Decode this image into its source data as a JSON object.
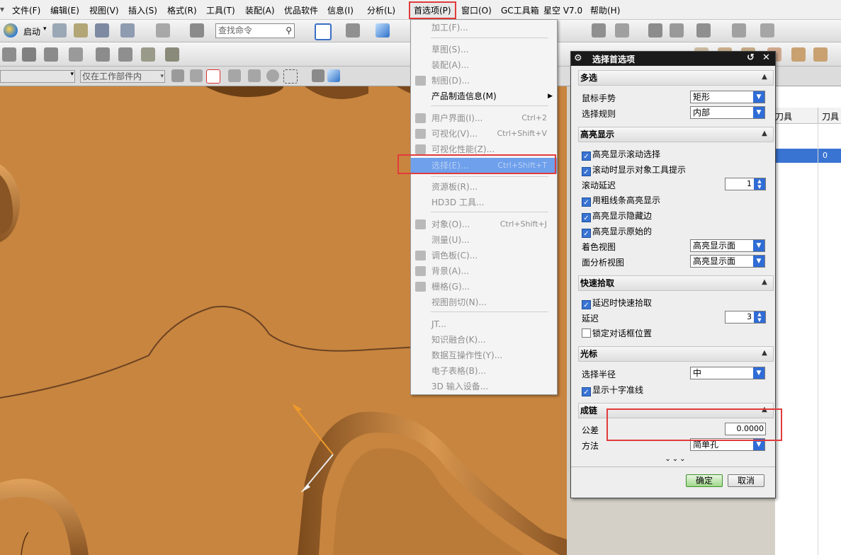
{
  "menubar": {
    "items": [
      "文件(F)",
      "编辑(E)",
      "视图(V)",
      "插入(S)",
      "格式(R)",
      "工具(T)",
      "装配(A)",
      "优品软件",
      "信息(I)",
      "分析(L)",
      "首选项(P)",
      "窗口(O)",
      "GC工具箱",
      "星空 V7.0",
      "帮助(H)"
    ],
    "active_item": "首选项(P)"
  },
  "toolbar": {
    "start_label": "启动",
    "search_placeholder": "查找命令",
    "filter_label": "仅在工作部件内"
  },
  "dropdown": {
    "items": [
      {
        "label": "加工(F)...",
        "shortcut": "",
        "enabled": false
      },
      {
        "label": "草图(S)...",
        "shortcut": "",
        "enabled": false
      },
      {
        "label": "装配(A)...",
        "shortcut": "",
        "enabled": false
      },
      {
        "label": "制图(D)...",
        "shortcut": "",
        "enabled": false
      },
      {
        "label": "产品制造信息(M)",
        "shortcut": "",
        "enabled": true,
        "submenu": "▶"
      },
      {
        "label": "用户界面(I)...",
        "shortcut": "Ctrl+2",
        "enabled": false
      },
      {
        "label": "可视化(V)...",
        "shortcut": "Ctrl+Shift+V",
        "enabled": false
      },
      {
        "label": "可视化性能(Z)...",
        "shortcut": "",
        "enabled": false
      },
      {
        "label": "选择(E)...",
        "shortcut": "Ctrl+Shift+T",
        "enabled": true,
        "selected": true
      },
      {
        "label": "资源板(R)...",
        "shortcut": "",
        "enabled": false
      },
      {
        "label": "HD3D 工具...",
        "shortcut": "",
        "enabled": false
      },
      {
        "label": "对象(O)...",
        "shortcut": "Ctrl+Shift+J",
        "enabled": false
      },
      {
        "label": "测量(U)...",
        "shortcut": "",
        "enabled": false
      },
      {
        "label": "调色板(C)...",
        "shortcut": "",
        "enabled": false
      },
      {
        "label": "背景(A)...",
        "shortcut": "",
        "enabled": false
      },
      {
        "label": "栅格(G)...",
        "shortcut": "",
        "enabled": false
      },
      {
        "label": "视图剖切(N)...",
        "shortcut": "",
        "enabled": false
      },
      {
        "label": "JT...",
        "shortcut": "",
        "enabled": false
      },
      {
        "label": "知识融合(K)...",
        "shortcut": "",
        "enabled": false
      },
      {
        "label": "数据互操作性(Y)...",
        "shortcut": "",
        "enabled": false
      },
      {
        "label": "电子表格(B)...",
        "shortcut": "",
        "enabled": false
      },
      {
        "label": "3D 输入设备...",
        "shortcut": "",
        "enabled": false
      }
    ]
  },
  "dialog": {
    "title": "选择首选项",
    "sections": {
      "multiselect": {
        "title": "多选",
        "gesture_label": "鼠标手势",
        "gesture_value": "矩形",
        "rule_label": "选择规则",
        "rule_value": "内部"
      },
      "highlight": {
        "title": "高亮显示",
        "scroll_select": "高亮显示滚动选择",
        "scroll_tooltip": "滚动时显示对象工具提示",
        "scroll_delay_label": "滚动延迟",
        "scroll_delay_value": "1",
        "thick_line": "用粗线条高亮显示",
        "hidden_edges": "高亮显示隐藏边",
        "original": "高亮显示原始的",
        "shaded_label": "着色视图",
        "shaded_value": "高亮显示面",
        "face_analysis_label": "面分析视图",
        "face_analysis_value": "高亮显示面"
      },
      "quickpick": {
        "title": "快速拾取",
        "delayed": "延迟时快速拾取",
        "delay_label": "延迟",
        "delay_value": "3",
        "lock_position": "锁定对话框位置"
      },
      "cursor": {
        "title": "光标",
        "radius_label": "选择半径",
        "radius_value": "中",
        "crosshair": "显示十字准线"
      },
      "chain": {
        "title": "成链",
        "tolerance_label": "公差",
        "tolerance_value": "0.0000",
        "method_label": "方法",
        "method_value": "简单孔"
      }
    },
    "ok_label": "确定",
    "cancel_label": "取消"
  },
  "grid": {
    "col1": "刀具",
    "col2": "刀具",
    "cell_value": "0"
  },
  "colors": {
    "viewport": "#c8853f",
    "selection": "#6ea0ec",
    "highlight_box": "#e23b3b",
    "title_bar": "#1a1a1a"
  }
}
